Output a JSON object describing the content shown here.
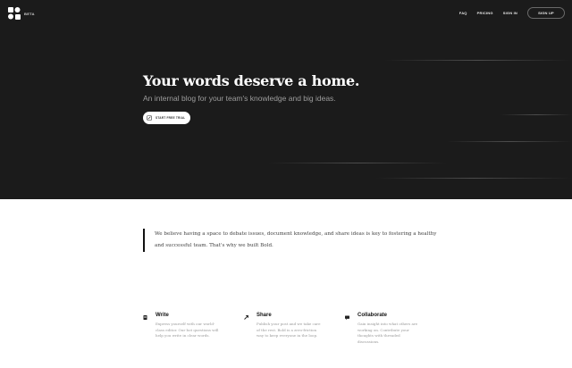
{
  "brand": {
    "badge": "BETA"
  },
  "nav": {
    "links": [
      "FAQ",
      "PRICING",
      "SIGN IN"
    ],
    "signup_label": "SIGN UP"
  },
  "hero": {
    "title": "Your words deserve a home.",
    "subtitle": "An internal blog for your team's knowledge and big ideas.",
    "cta_label": "START FREE TRIAL"
  },
  "mission": {
    "text": "We believe having a space to debate issues, document knowledge, and share ideas is key to fostering a healthy and successful team. That's why we built Bold."
  },
  "features": [
    {
      "icon": "document-icon",
      "title": "Write",
      "text": "Express yourself with our world-class editor. Our bot questions will help you write in clear words."
    },
    {
      "icon": "share-icon",
      "title": "Share",
      "text": "Publish your post and we take care of the rest. Bold is a zero-friction way to keep everyone in the loop."
    },
    {
      "icon": "chat-icon",
      "title": "Collaborate",
      "text": "Gain insight into what others are working on. Contribute your thoughts with threaded discussions."
    }
  ],
  "colors": {
    "hero_bg": "#1b1b1b",
    "accent": "#111111",
    "muted_text": "#9a9a9a"
  }
}
